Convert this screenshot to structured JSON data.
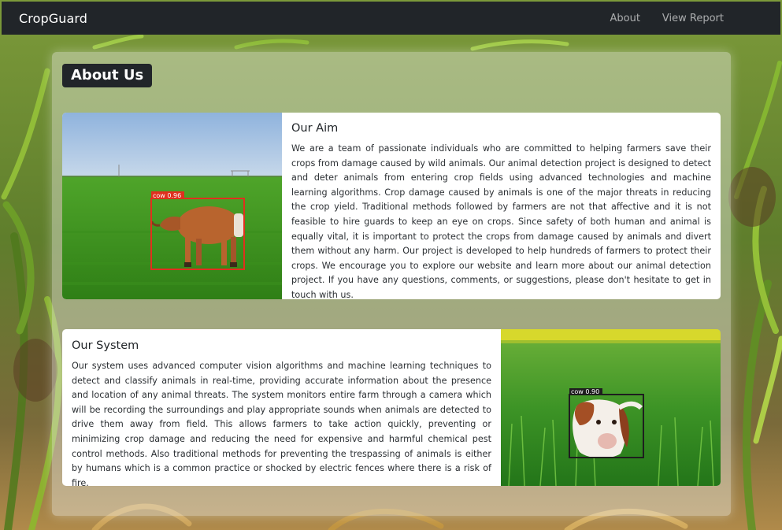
{
  "navbar": {
    "brand": "CropGuard",
    "links": [
      "About",
      "View Report"
    ]
  },
  "page": {
    "heading": "About Us"
  },
  "sections": [
    {
      "title": "Our Aim",
      "text": "We are a team of passionate individuals who are committed to helping farmers save their crops from damage caused by wild animals. Our animal detection project is designed to detect and deter animals from entering crop fields using advanced technologies and machine learning algorithms. Crop damage caused by animals is one of the major threats in reducing the crop yield. Traditional methods followed by farmers are not that affective and it is not feasible to hire guards to keep an eye on crops. Since safety of both human and animal is equally vital, it is important to protect the crops from damage caused by animals and divert them without any harm. Our project is developed to help hundreds of farmers to protect their crops. We encourage you to explore our website and learn more about our animal detection project. If you have any questions, comments, or suggestions, please don't hesitate to get in touch with us.",
      "image": {
        "subject": "cow",
        "detection_label": "cow 0.96"
      }
    },
    {
      "title": "Our System",
      "text": "Our system uses advanced computer vision algorithms and machine learning techniques to detect and classify animals in real-time, providing accurate information about the presence and location of any animal threats. The system monitors entire farm through a camera which will be recording the surroundings and play appropriate sounds when animals are detected to drive them away from field. This allows farmers to take action quickly, preventing or minimizing crop damage and reducing the need for expensive and harmful chemical pest control methods. Also traditional methods for preventing the trespassing of animals is either by humans which is a common practice or shocked by electric fences where there is a risk of fire.",
      "image": {
        "subject": "calf",
        "detection_label": "cow 0.90"
      }
    }
  ],
  "colors": {
    "navbar_bg": "#212529",
    "badge_bg": "#212529",
    "detection_box_1": "#e0301e",
    "detection_box_2": "#1e1e1e",
    "grass": "#3f8f1e"
  }
}
